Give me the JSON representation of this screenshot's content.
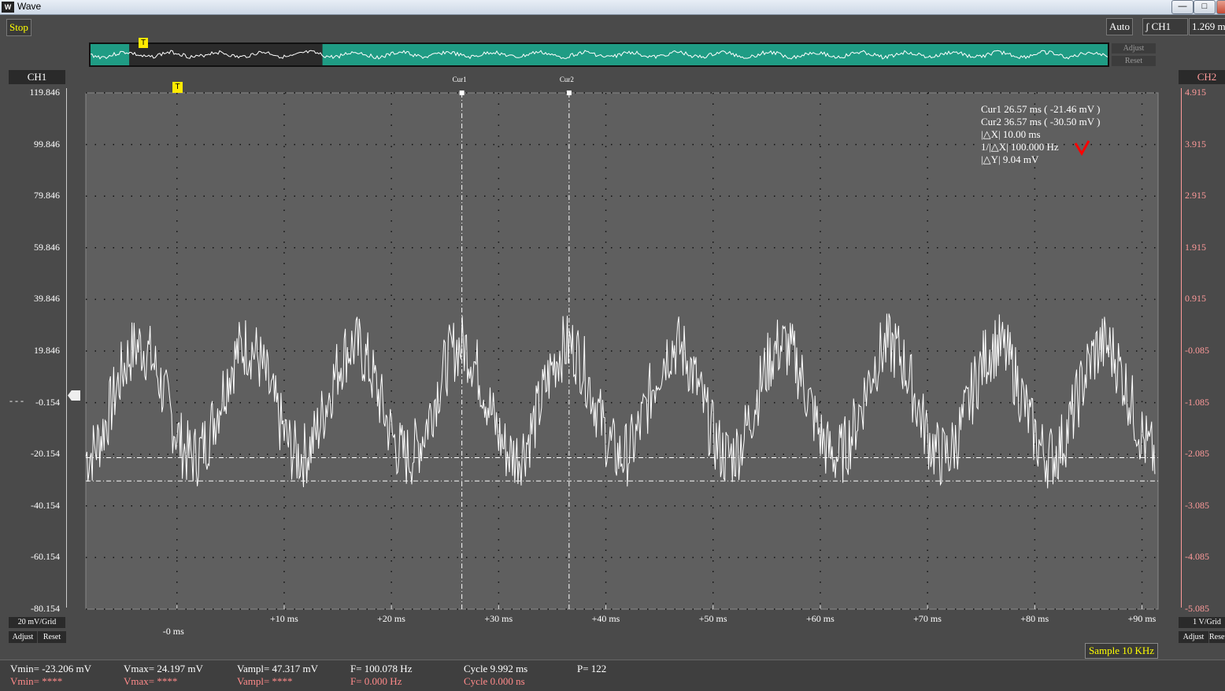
{
  "window": {
    "title": "Wave",
    "icon": "W",
    "min": "—",
    "max": "□",
    "close": "✕"
  },
  "toolbar": {
    "stop": "Stop",
    "auto": "Auto",
    "trigger_ch": "CH1",
    "time_value": "1.269 m"
  },
  "overview": {
    "adjust": "Adjust",
    "reset": "Reset",
    "trigger_marker": "T",
    "window_start": 0.038,
    "window_end": 0.228
  },
  "ch1": {
    "label": "CH1",
    "grid": "20 mV/Grid",
    "adjust": "Adjust",
    "reset": "Reset",
    "ticks": [
      "119.846",
      "99.846",
      "79.846",
      "59.846",
      "39.846",
      "19.846",
      "-0.154",
      "-20.154",
      "-40.154",
      "-60.154",
      "-80.154"
    ],
    "zero_marker": "- - -"
  },
  "ch2": {
    "label": "CH2",
    "grid": "1 V/Grid",
    "adjust": "Adjust",
    "reset": "Reset",
    "ticks": [
      "4.915",
      "3.915",
      "2.915",
      "1.915",
      "0.915",
      "-0.085",
      "-1.085",
      "-2.085",
      "-3.085",
      "-4.085",
      "-5.085"
    ]
  },
  "x_ticks": [
    "-0 ms",
    "+10 ms",
    "+20 ms",
    "+30 ms",
    "+40 ms",
    "+50 ms",
    "+60 ms",
    "+70 ms",
    "+80 ms",
    "+90 ms"
  ],
  "trigger_marker": "T",
  "cursors": {
    "cur1_label": "Cur1",
    "cur2_label": "Cur2"
  },
  "readout": {
    "cur1": "Cur1   26.57 ms ( -21.46 mV )",
    "cur2": "Cur2   36.57 ms ( -30.50 mV )",
    "dx": "|△X|   10.00 ms",
    "inv_dx": "1/|△X| 100.000 Hz",
    "dy": "|△Y|   9.04 mV"
  },
  "sample_rate": "Sample 10 KHz",
  "measurements": {
    "vmin": "Vmin= -23.206 mV",
    "vmax": "Vmax= 24.197 mV",
    "vampl": "Vampl= 47.317 mV",
    "freq": "F= 100.078 Hz",
    "cycle": "Cycle 9.992 ms",
    "p": "P= 122",
    "vmin2": "Vmin= ****",
    "vmax2": "Vmax= ****",
    "vampl2": "Vampl= ****",
    "freq2": "F= 0.000 Hz",
    "cycle2": "Cycle 0.000 ns"
  },
  "colors": {
    "trace": "#ffffff",
    "plot_bg": "#5f5f5f",
    "overview_bg": "#1f9c84",
    "ch2": "#ff9a9a",
    "accent": "#ffff00",
    "check_mark": "#ff0000"
  },
  "chart_data": {
    "type": "line",
    "x_unit": "ms",
    "x_range": [
      -8.5,
      91.5
    ],
    "y_unit": "mV",
    "y_range": [
      -80.154,
      119.846
    ],
    "signal": {
      "frequency_hz": 100.078,
      "vmin_mv": -23.206,
      "vmax_mv": 24.197,
      "period_ms": 9.992
    },
    "cursor1": {
      "x": 26.57,
      "y": -21.46
    },
    "cursor2": {
      "x": 36.57,
      "y": -30.5
    }
  }
}
